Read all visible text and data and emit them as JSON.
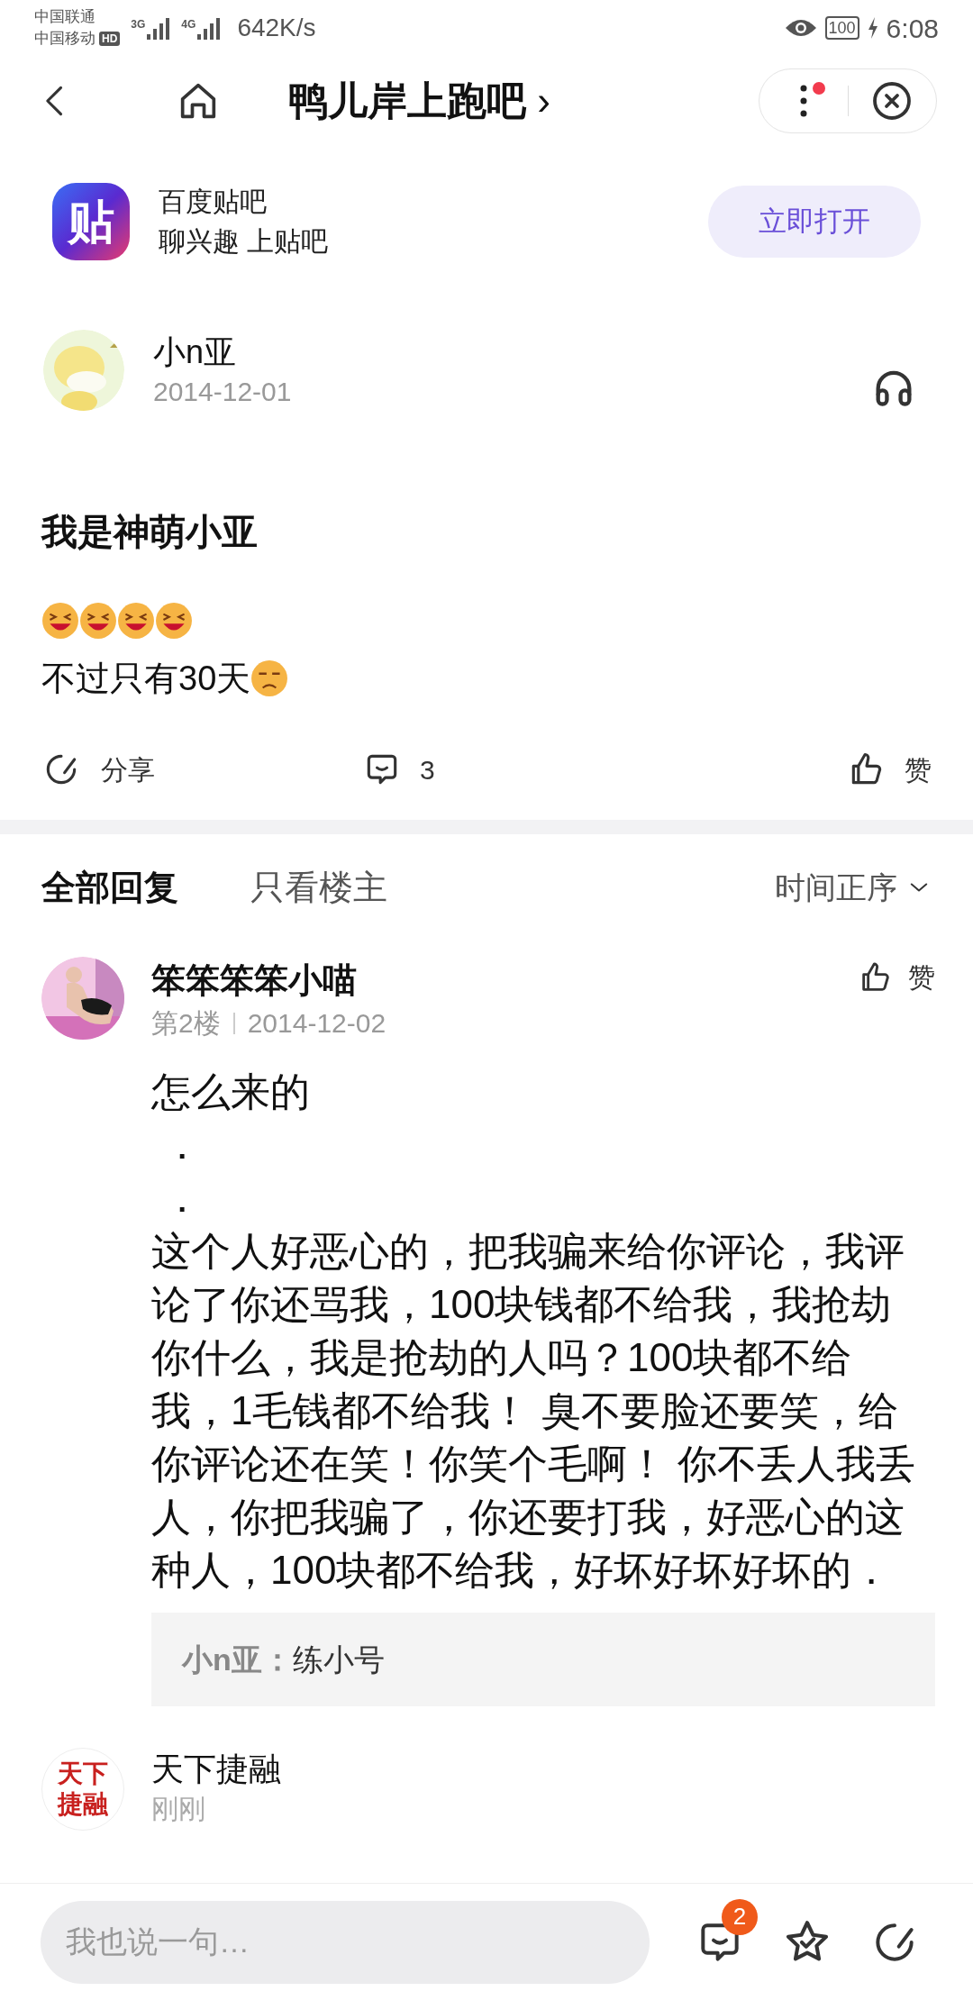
{
  "status_bar": {
    "carriers": [
      "中国联通",
      "中国移动"
    ],
    "hd": "HD",
    "networks": [
      "3G",
      "4G"
    ],
    "speed": "642K/s",
    "battery": "100",
    "time": "6:08"
  },
  "nav": {
    "title": "鸭儿岸上跑吧",
    "chevron": "›",
    "menu_badge": true
  },
  "app_banner": {
    "name": "百度贴吧",
    "slogan": "聊兴趣 上贴吧",
    "logo": "贴",
    "button": "立即打开"
  },
  "post": {
    "author": "小n亚",
    "date": "2014-12-01",
    "title": "我是神萌小亚",
    "lines": [
      {
        "emojis": [
          {
            "kind": "laugh"
          },
          {
            "kind": "laugh"
          },
          {
            "kind": "laugh"
          },
          {
            "kind": "laugh"
          }
        ]
      },
      {
        "text": "不过只有30天",
        "emojis": [
          {
            "kind": "frown"
          }
        ]
      }
    ],
    "actions": {
      "share": "分享",
      "comments": "3",
      "like": "赞"
    }
  },
  "reply_tabs": [
    {
      "label": "全部回复",
      "selected": true
    },
    {
      "label": "只看楼主",
      "selected": false
    }
  ],
  "sort": "时间正序",
  "replies": [
    {
      "kind": "reply",
      "name": "笨笨笨笨小喵",
      "floor": "第2楼",
      "date": "2014-12-02",
      "like": "赞",
      "lines": [
        "怎么来的",
        "．",
        "．",
        "这个人好恶心的，把我骗来给你评论，我评论了你还骂我，100块钱都不给我，我抢劫你什么，我是抢劫的人吗？100块都不给我，1毛钱都不给我！ 臭不要脸还要笑，给你评论还在笑！你笑个毛啊！ 你不丢人我丢人，你把我骗了，你还要打我，好恶心的这种人，100块都不给我，好坏好坏好坏的．"
      ],
      "quote": {
        "author": "小n亚：",
        "text": "练小号"
      }
    },
    {
      "kind": "ad",
      "name": "天下捷融",
      "date": "刚刚",
      "avatar_text": [
        "天下",
        "捷融"
      ]
    }
  ],
  "bottom_bar": {
    "placeholder": "我也说一句…",
    "badge": "2"
  }
}
